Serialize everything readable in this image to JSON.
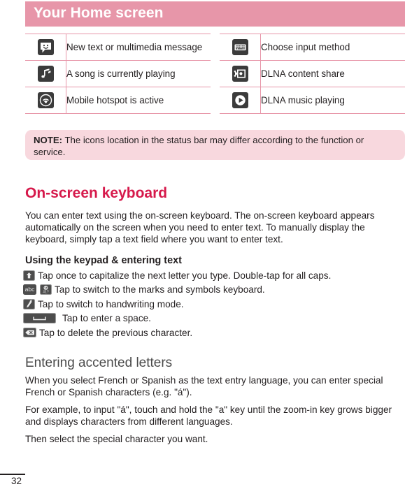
{
  "header": {
    "title": "Your Home screen",
    "bar_color": "#e796a9"
  },
  "status_icon_table": {
    "left_column": [
      {
        "icon": "message-bubble-icon",
        "label": "New text or multimedia message"
      },
      {
        "icon": "music-note-icon",
        "label": "A song is currently playing"
      },
      {
        "icon": "hotspot-signal-icon",
        "label": "Mobile hotspot is active"
      }
    ],
    "right_column": [
      {
        "icon": "keyboard-icon",
        "label": "Choose input method"
      },
      {
        "icon": "dlna-share-icon",
        "label": "DLNA content share"
      },
      {
        "icon": "play-circle-icon",
        "label": "DLNA music playing"
      }
    ]
  },
  "note": {
    "label": "NOTE:",
    "text": " The icons location in the status bar may differ according to the function or service.",
    "background": "#f8d8de"
  },
  "section": {
    "heading": "On-screen keyboard",
    "heading_color": "#d6194b",
    "intro": "You can enter text using the on-screen keyboard. The on-screen keyboard appears automatically on the screen when you need to enter text. To manually display the keyboard, simply tap a text field where you want to enter text."
  },
  "keypad": {
    "subheading": "Using the keypad & entering text",
    "lines": [
      {
        "icon": "shift-key-icon",
        "text": "Tap once to capitalize the next letter you type. Double-tap for all caps."
      },
      {
        "icon": "abc-key-icon",
        "icon2": "symbols-key-icon",
        "text": "Tap to switch to the marks and symbols keyboard."
      },
      {
        "icon": "handwriting-key-icon",
        "text": "Tap to switch to handwriting mode."
      },
      {
        "icon": "space-key-icon",
        "text": "Tap to enter a space."
      },
      {
        "icon": "delete-key-icon",
        "text": "Tap to delete the previous character."
      }
    ],
    "abc_key_label": "abc"
  },
  "accented": {
    "heading": "Entering accented letters",
    "para1": "When you select French or Spanish as the text entry language, you can enter special French or Spanish characters (e.g. \"á\").",
    "para2": "For example, to input \"á\", touch and hold the \"a\" key until the zoom-in key grows bigger and displays characters from different languages.",
    "para3": "Then select the special character you want."
  },
  "footer": {
    "page_number": "32"
  }
}
